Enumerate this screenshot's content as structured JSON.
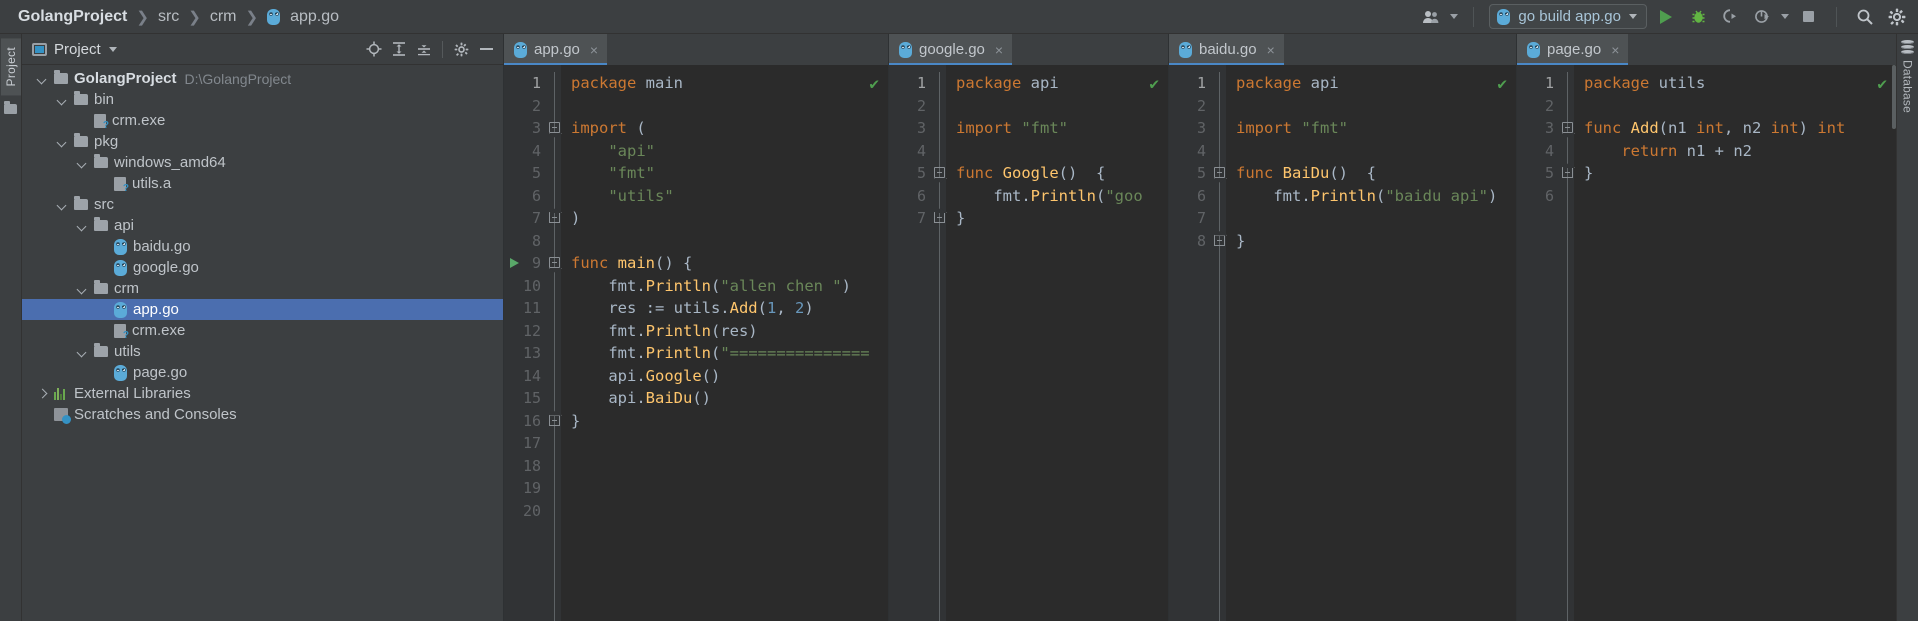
{
  "breadcrumb": {
    "root": "GolangProject",
    "items": [
      "src",
      "crm",
      "app.go"
    ],
    "separator": "❯"
  },
  "toolbar": {
    "user_icon": "users-icon",
    "run_config": {
      "icon": "go-run-icon",
      "label": "go build app.go",
      "dropdown": "chevron-down-icon"
    },
    "run_label": "Run",
    "debug_label": "Debug",
    "coverage_label": "Run with Coverage",
    "profile_label": "Profile",
    "stop_label": "Stop",
    "search_label": "Search Everywhere",
    "settings_label": "Settings"
  },
  "left_strip": {
    "project_tab": "Project",
    "folder_icon": "folder-icon"
  },
  "right_strip": {
    "database_tab": "Database",
    "database_icon": "database-icon"
  },
  "project_panel": {
    "title": "Project",
    "dropdown": "chevron-down-icon",
    "tools": [
      "locate-icon",
      "expand-all-icon",
      "collapse-all-icon",
      "gear-icon",
      "minimize-icon"
    ],
    "tree": [
      {
        "label": "GolangProject",
        "path": "D:\\GolangProject",
        "indent": 0,
        "arrow": "down",
        "icon": "folder",
        "bold": true,
        "selected": false
      },
      {
        "label": "bin",
        "path": "",
        "indent": 1,
        "arrow": "down",
        "icon": "folder",
        "bold": false,
        "selected": false
      },
      {
        "label": "crm.exe",
        "path": "",
        "indent": 2,
        "arrow": "none",
        "icon": "binary",
        "bold": false,
        "selected": false
      },
      {
        "label": "pkg",
        "path": "",
        "indent": 1,
        "arrow": "down",
        "icon": "folder",
        "bold": false,
        "selected": false
      },
      {
        "label": "windows_amd64",
        "path": "",
        "indent": 2,
        "arrow": "down",
        "icon": "folder",
        "bold": false,
        "selected": false
      },
      {
        "label": "utils.a",
        "path": "",
        "indent": 3,
        "arrow": "none",
        "icon": "binary",
        "bold": false,
        "selected": false
      },
      {
        "label": "src",
        "path": "",
        "indent": 1,
        "arrow": "down",
        "icon": "folder",
        "bold": false,
        "selected": false
      },
      {
        "label": "api",
        "path": "",
        "indent": 2,
        "arrow": "down",
        "icon": "folder",
        "bold": false,
        "selected": false
      },
      {
        "label": "baidu.go",
        "path": "",
        "indent": 3,
        "arrow": "none",
        "icon": "go",
        "bold": false,
        "selected": false
      },
      {
        "label": "google.go",
        "path": "",
        "indent": 3,
        "arrow": "none",
        "icon": "go",
        "bold": false,
        "selected": false
      },
      {
        "label": "crm",
        "path": "",
        "indent": 2,
        "arrow": "down",
        "icon": "folder",
        "bold": false,
        "selected": false
      },
      {
        "label": "app.go",
        "path": "",
        "indent": 3,
        "arrow": "none",
        "icon": "go",
        "bold": false,
        "selected": true
      },
      {
        "label": "crm.exe",
        "path": "",
        "indent": 3,
        "arrow": "none",
        "icon": "binary",
        "bold": false,
        "selected": false
      },
      {
        "label": "utils",
        "path": "",
        "indent": 2,
        "arrow": "down",
        "icon": "folder",
        "bold": false,
        "selected": false
      },
      {
        "label": "page.go",
        "path": "",
        "indent": 3,
        "arrow": "none",
        "icon": "go",
        "bold": false,
        "selected": false
      },
      {
        "label": "External Libraries",
        "path": "",
        "indent": 0,
        "arrow": "right",
        "icon": "library",
        "bold": false,
        "selected": false
      },
      {
        "label": "Scratches and Consoles",
        "path": "",
        "indent": 0,
        "arrow": "none",
        "icon": "scratch",
        "bold": false,
        "selected": false
      }
    ]
  },
  "editors": [
    {
      "tab": "app.go",
      "close": "×",
      "inspection": "✔",
      "line_count": 20,
      "run_gutter_line": 9,
      "lines": [
        {
          "n": 1,
          "tokens": [
            {
              "t": "package ",
              "c": "kw"
            },
            {
              "t": "main",
              "c": "pl"
            }
          ]
        },
        {
          "n": 2,
          "tokens": []
        },
        {
          "n": 3,
          "tokens": [
            {
              "t": "import",
              "c": "kw"
            },
            {
              "t": " (",
              "c": "pl"
            }
          ],
          "fold": "open"
        },
        {
          "n": 4,
          "tokens": [
            {
              "t": "    \"api\"",
              "c": "st"
            }
          ]
        },
        {
          "n": 5,
          "tokens": [
            {
              "t": "    \"fmt\"",
              "c": "st"
            }
          ]
        },
        {
          "n": 6,
          "tokens": [
            {
              "t": "    \"utils\"",
              "c": "st"
            }
          ]
        },
        {
          "n": 7,
          "tokens": [
            {
              "t": ")",
              "c": "pl"
            }
          ],
          "fold": "close"
        },
        {
          "n": 8,
          "tokens": []
        },
        {
          "n": 9,
          "tokens": [
            {
              "t": "func ",
              "c": "kw"
            },
            {
              "t": "main",
              "c": "fn"
            },
            {
              "t": "() {",
              "c": "pl"
            }
          ],
          "fold": "open"
        },
        {
          "n": 10,
          "tokens": [
            {
              "t": "    fmt.",
              "c": "pl"
            },
            {
              "t": "Println",
              "c": "fn"
            },
            {
              "t": "(",
              "c": "pl"
            },
            {
              "t": "\"allen chen \"",
              "c": "st"
            },
            {
              "t": ")",
              "c": "pl"
            }
          ]
        },
        {
          "n": 11,
          "tokens": [
            {
              "t": "    res := utils.",
              "c": "pl"
            },
            {
              "t": "Add",
              "c": "fn"
            },
            {
              "t": "(",
              "c": "pl"
            },
            {
              "t": "1",
              "c": "num"
            },
            {
              "t": ", ",
              "c": "pl"
            },
            {
              "t": "2",
              "c": "num"
            },
            {
              "t": ")",
              "c": "pl"
            }
          ]
        },
        {
          "n": 12,
          "tokens": [
            {
              "t": "    fmt.",
              "c": "pl"
            },
            {
              "t": "Println",
              "c": "fn"
            },
            {
              "t": "(res)",
              "c": "pl"
            }
          ]
        },
        {
          "n": 13,
          "tokens": [
            {
              "t": "    fmt.",
              "c": "pl"
            },
            {
              "t": "Println",
              "c": "fn"
            },
            {
              "t": "(",
              "c": "pl"
            },
            {
              "t": "\"===============",
              "c": "st"
            }
          ]
        },
        {
          "n": 14,
          "tokens": [
            {
              "t": "    api.",
              "c": "pl"
            },
            {
              "t": "Google",
              "c": "fn"
            },
            {
              "t": "()",
              "c": "pl"
            }
          ]
        },
        {
          "n": 15,
          "tokens": [
            {
              "t": "    api.",
              "c": "pl"
            },
            {
              "t": "BaiDu",
              "c": "fn"
            },
            {
              "t": "()",
              "c": "pl"
            }
          ]
        },
        {
          "n": 16,
          "tokens": [
            {
              "t": "}",
              "c": "pl"
            }
          ],
          "fold": "close"
        },
        {
          "n": 17,
          "tokens": []
        },
        {
          "n": 18,
          "tokens": []
        },
        {
          "n": 19,
          "tokens": []
        },
        {
          "n": 20,
          "tokens": []
        }
      ]
    },
    {
      "tab": "google.go",
      "close": "×",
      "inspection": "✔",
      "line_count": 7,
      "run_gutter_line": 0,
      "lines": [
        {
          "n": 1,
          "tokens": [
            {
              "t": "package ",
              "c": "kw"
            },
            {
              "t": "api",
              "c": "pl"
            }
          ]
        },
        {
          "n": 2,
          "tokens": []
        },
        {
          "n": 3,
          "tokens": [
            {
              "t": "import ",
              "c": "kw"
            },
            {
              "t": "\"fmt\"",
              "c": "st"
            }
          ]
        },
        {
          "n": 4,
          "tokens": []
        },
        {
          "n": 5,
          "tokens": [
            {
              "t": "func ",
              "c": "kw"
            },
            {
              "t": "Google",
              "c": "fn"
            },
            {
              "t": "()  {",
              "c": "pl"
            }
          ],
          "fold": "open"
        },
        {
          "n": 6,
          "tokens": [
            {
              "t": "    fmt.",
              "c": "pl"
            },
            {
              "t": "Println",
              "c": "fn"
            },
            {
              "t": "(",
              "c": "pl"
            },
            {
              "t": "\"goo",
              "c": "st"
            }
          ]
        },
        {
          "n": 7,
          "tokens": [
            {
              "t": "}",
              "c": "pl"
            }
          ],
          "fold": "close"
        }
      ]
    },
    {
      "tab": "baidu.go",
      "close": "×",
      "inspection": "✔",
      "line_count": 8,
      "run_gutter_line": 0,
      "lines": [
        {
          "n": 1,
          "tokens": [
            {
              "t": "package ",
              "c": "kw"
            },
            {
              "t": "api",
              "c": "pl"
            }
          ]
        },
        {
          "n": 2,
          "tokens": []
        },
        {
          "n": 3,
          "tokens": [
            {
              "t": "import ",
              "c": "kw"
            },
            {
              "t": "\"fmt\"",
              "c": "st"
            }
          ]
        },
        {
          "n": 4,
          "tokens": []
        },
        {
          "n": 5,
          "tokens": [
            {
              "t": "func ",
              "c": "kw"
            },
            {
              "t": "BaiDu",
              "c": "fn"
            },
            {
              "t": "()  {",
              "c": "pl"
            }
          ],
          "fold": "open"
        },
        {
          "n": 6,
          "tokens": [
            {
              "t": "    fmt.",
              "c": "pl"
            },
            {
              "t": "Println",
              "c": "fn"
            },
            {
              "t": "(",
              "c": "pl"
            },
            {
              "t": "\"baidu api\"",
              "c": "st"
            },
            {
              "t": ")",
              "c": "pl"
            }
          ]
        },
        {
          "n": 7,
          "tokens": []
        },
        {
          "n": 8,
          "tokens": [
            {
              "t": "}",
              "c": "pl"
            }
          ],
          "fold": "close"
        }
      ]
    },
    {
      "tab": "page.go",
      "close": "×",
      "inspection": "✔",
      "line_count": 6,
      "run_gutter_line": 0,
      "lines": [
        {
          "n": 1,
          "tokens": [
            {
              "t": "package ",
              "c": "kw"
            },
            {
              "t": "utils",
              "c": "pl"
            }
          ]
        },
        {
          "n": 2,
          "tokens": []
        },
        {
          "n": 3,
          "tokens": [
            {
              "t": "func ",
              "c": "kw"
            },
            {
              "t": "Add",
              "c": "fn"
            },
            {
              "t": "(n1 ",
              "c": "pl"
            },
            {
              "t": "int",
              "c": "kw"
            },
            {
              "t": ", n2 ",
              "c": "pl"
            },
            {
              "t": "int",
              "c": "kw"
            },
            {
              "t": ") ",
              "c": "pl"
            },
            {
              "t": "int",
              "c": "kw"
            }
          ],
          "fold": "open"
        },
        {
          "n": 4,
          "tokens": [
            {
              "t": "    ",
              "c": "pl"
            },
            {
              "t": "return",
              "c": "kw"
            },
            {
              "t": " n1 + n2",
              "c": "pl"
            }
          ]
        },
        {
          "n": 5,
          "tokens": [
            {
              "t": "}",
              "c": "pl"
            }
          ],
          "fold": "close"
        },
        {
          "n": 6,
          "tokens": []
        }
      ]
    }
  ],
  "colors": {
    "accent": "#4b6eaf",
    "keyword": "#cc7832",
    "string": "#6a8759",
    "function": "#ffc66d",
    "number": "#6897bb",
    "ok_green": "#4f9e4f",
    "editor_bg": "#2b2b2b",
    "panel_bg": "#3c3f41"
  }
}
